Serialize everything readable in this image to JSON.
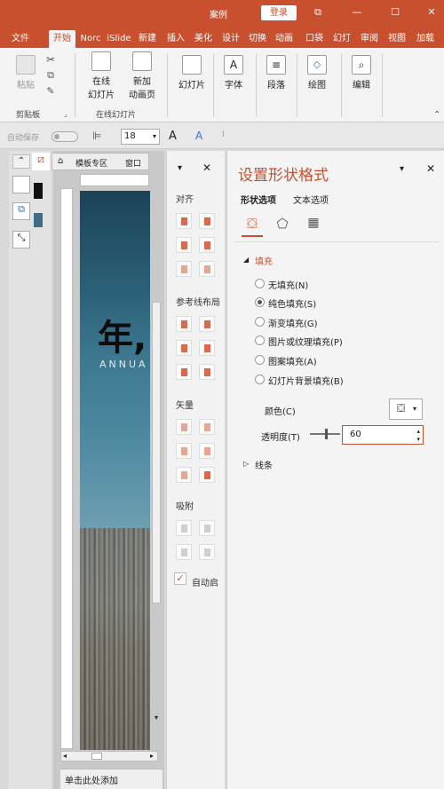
{
  "titlebar": {
    "doc_title": "案例",
    "login": "登录",
    "controls": [
      "⧉",
      "—",
      "☐",
      "✕"
    ]
  },
  "tabs": [
    {
      "label": "文件",
      "active": false
    },
    {
      "label": "开始",
      "active": true
    },
    {
      "label": "Norc",
      "active": false
    },
    {
      "label": "iSlide",
      "active": false
    },
    {
      "label": "新建",
      "active": false
    },
    {
      "label": "插入",
      "active": false
    },
    {
      "label": "美化",
      "active": false
    },
    {
      "label": "设计",
      "active": false
    },
    {
      "label": "切换",
      "active": false
    },
    {
      "label": "动画",
      "active": false
    },
    {
      "label": "口袋",
      "active": false
    },
    {
      "label": "幻灯",
      "active": false
    },
    {
      "label": "审阅",
      "active": false
    },
    {
      "label": "视图",
      "active": false
    },
    {
      "label": "加载",
      "active": false
    }
  ],
  "ribbon": {
    "paste": "粘贴",
    "clipboard_group": "剪贴板",
    "online_slide": [
      "在线",
      "幻灯片"
    ],
    "new_anim_page": [
      "新加",
      "动画页"
    ],
    "online_group": "在线幻灯片",
    "slides": "幻灯片",
    "font": "字体",
    "paragraph": "段落",
    "drawing": "绘图",
    "editing": "编辑"
  },
  "qat": {
    "autosave": "自动保存",
    "font_size": "18"
  },
  "thumb_pane": {
    "tab_label": "模板专区",
    "tab2": "窗口"
  },
  "slide": {
    "title": "年,",
    "subtitle": "ANNUA",
    "notes": "单击此处添加"
  },
  "arrange": {
    "align": "对齐",
    "guides": "参考线布局",
    "vector": "矢量",
    "snap": "吸附",
    "auto_snap": "自动启"
  },
  "format_pane": {
    "title": "设置形状格式",
    "tabs": [
      "形状选项",
      "文本选项"
    ],
    "fill_section": "填充",
    "fill_options": [
      {
        "label": "无填充(N)",
        "checked": false
      },
      {
        "label": "纯色填充(S)",
        "checked": true
      },
      {
        "label": "渐变填充(G)",
        "checked": false
      },
      {
        "label": "图片或纹理填充(P)",
        "checked": false
      },
      {
        "label": "图案填充(A)",
        "checked": false
      },
      {
        "label": "幻灯片背景填充(B)",
        "checked": false
      }
    ],
    "color_label": "颜色(C)",
    "transparency_label": "透明度(T)",
    "transparency_value": "60",
    "line_section": "线条"
  },
  "colors": {
    "accent": "#c8502f",
    "ribbon_bg": "#f3f3f3"
  }
}
